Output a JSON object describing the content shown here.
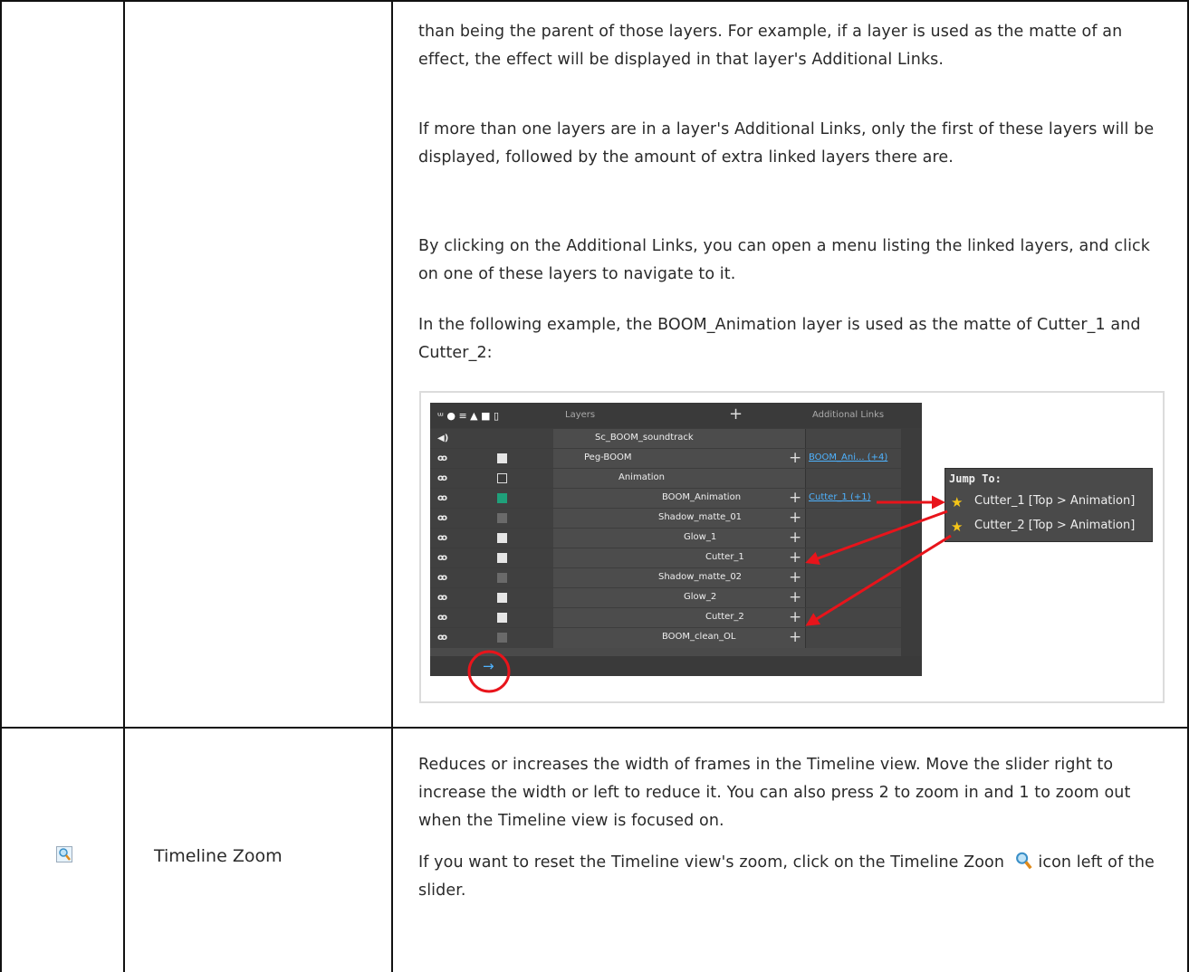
{
  "row1": {
    "paragraphs": [
      "than being the parent of those layers. For example, if a layer is used as the matte of an effect, the effect will be displayed in that layer's Additional Links.",
      "If more than one layers are in a layer's Additional Links, only the first of these layers will be displayed, followed by the amount of extra linked layers there are.",
      "By clicking on the Additional Links, you can open a menu listing the linked layers, and click on one of these layers to navigate to it.",
      "In the following example, the BOOM_Animation layer is used as the matte of Cutter_1 and Cutter_2:"
    ]
  },
  "figure": {
    "header_layers": "Layers",
    "header_links": "Additional Links",
    "rows": [
      {
        "name": "Sc_BOOM_soundtrack",
        "link": ""
      },
      {
        "name": "Peg-BOOM",
        "link": "BOOM_Ani... (+4)"
      },
      {
        "name": "Animation",
        "link": ""
      },
      {
        "name": "BOOM_Animation",
        "link": "Cutter_1 (+1)"
      },
      {
        "name": "Shadow_matte_01",
        "link": ""
      },
      {
        "name": "Glow_1",
        "link": ""
      },
      {
        "name": "Cutter_1",
        "link": ""
      },
      {
        "name": "Shadow_matte_02",
        "link": ""
      },
      {
        "name": "Glow_2",
        "link": ""
      },
      {
        "name": "Cutter_2",
        "link": ""
      },
      {
        "name": "BOOM_clean_OL",
        "link": ""
      }
    ],
    "jump_menu": {
      "title": "Jump To:",
      "items": [
        "Cutter_1 [Top > Animation]",
        "Cutter_2 [Top > Animation]"
      ]
    }
  },
  "row2": {
    "label": "Timeline Zoom",
    "paragraph1": "Reduces or increases the width of frames in the Timeline view. Move the slider right to increase the width or left to reduce it. You can also press 2 to zoom in and 1 to zoom out when the Timeline view is focused on.",
    "paragraph2a": "If you want to reset the Timeline view's zoom, click on the Timeline Zoon",
    "paragraph2b": "icon left of the slider."
  },
  "colors": {
    "accent_red": "#e8141b",
    "link_blue": "#4fb3ff",
    "star_yellow": "#f5c518"
  },
  "icons": [
    "zoom-icon",
    "star-icon",
    "arrow-icon"
  ]
}
